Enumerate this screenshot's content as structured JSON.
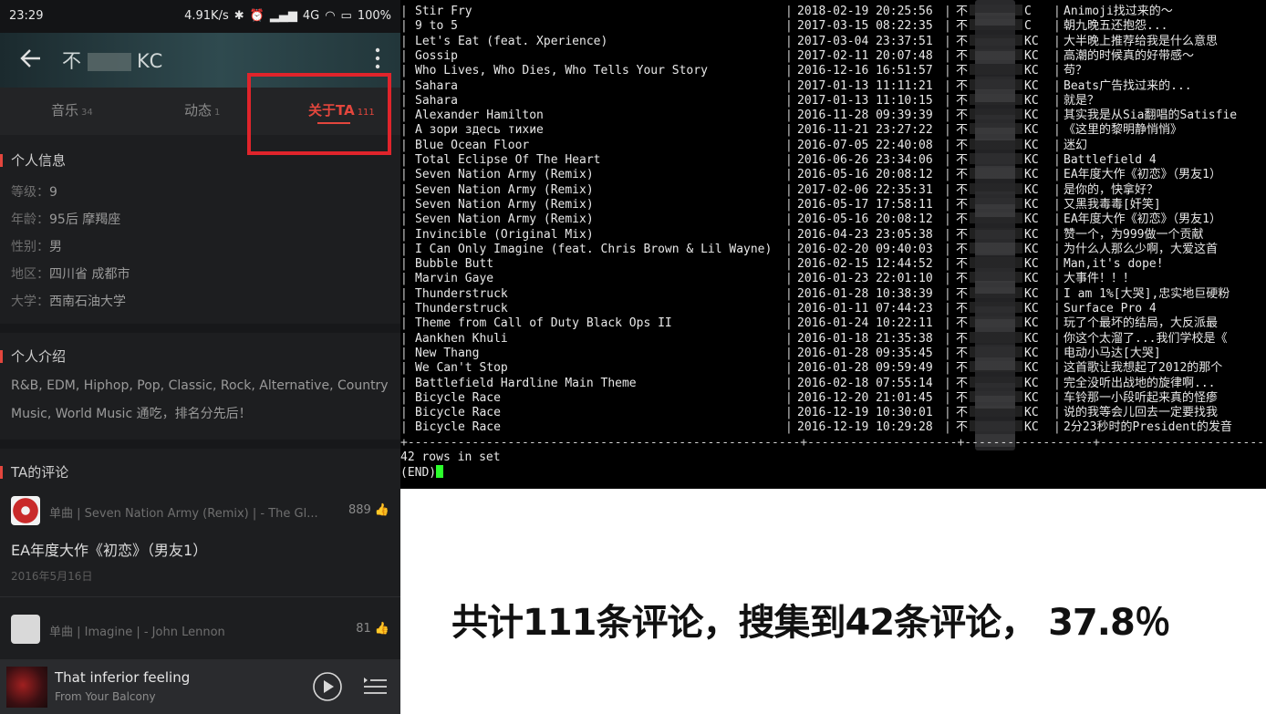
{
  "phone": {
    "status": {
      "time": "23:29",
      "speed": "4.91K/s",
      "network": "4G",
      "battery": "100%"
    },
    "header": {
      "title_prefix": "不",
      "title_suffix": "KC"
    },
    "tabs": [
      {
        "label": "音乐",
        "count": "34"
      },
      {
        "label": "动态",
        "count": "1"
      },
      {
        "label": "关于TA",
        "count": "111"
      }
    ],
    "personal_info": {
      "heading": "个人信息",
      "items": [
        {
          "label": "等级：",
          "value": "9"
        },
        {
          "label": "年龄：",
          "value": "95后 摩羯座"
        },
        {
          "label": "性别：",
          "value": "男"
        },
        {
          "label": "地区：",
          "value": "四川省 成都市"
        },
        {
          "label": "大学：",
          "value": "西南石油大学"
        }
      ]
    },
    "intro": {
      "heading": "个人介绍",
      "text": "R&B, EDM, Hiphop, Pop, Classic, Rock, Alternative, Country Music, World Music 通吃，排名分先后！"
    },
    "comments": {
      "heading": "TA的评论",
      "items": [
        {
          "song": "单曲 | Seven Nation Army (Remix) | - The Gl...",
          "likes": "889",
          "text": "EA年度大作《初恋》（男友1）",
          "date": "2016年5月16日"
        },
        {
          "song": "单曲 | Imagine | - John Lennon",
          "likes": "81",
          "text": "",
          "date": ""
        }
      ]
    },
    "player": {
      "song": "That inferior feeling",
      "artist": "From Your Balcony"
    }
  },
  "terminal": {
    "rows": [
      {
        "song": "Stir Fry",
        "time": "2018-02-19 20:25:56",
        "user_prefix": "不",
        "user_suffix": "C",
        "comment": "Animoji找过来的～"
      },
      {
        "song": "9 to 5",
        "time": "2017-03-15 08:22:35",
        "user_prefix": "不",
        "user_suffix": "C",
        "comment": "朝九晚五还抱怨..."
      },
      {
        "song": "Let's Eat (feat. Xperience)",
        "time": "2017-03-04 23:37:51",
        "user_prefix": "不",
        "user_suffix": "KC",
        "comment": "大半晚上推荐给我是什么意思"
      },
      {
        "song": "Gossip",
        "time": "2017-02-11 20:07:48",
        "user_prefix": "不",
        "user_suffix": "KC",
        "comment": "高潮的时候真的好带感～"
      },
      {
        "song": "Who Lives, Who Dies, Who Tells Your Story",
        "time": "2016-12-16 16:51:57",
        "user_prefix": "不",
        "user_suffix": "KC",
        "comment": "苟？"
      },
      {
        "song": "Sahara",
        "time": "2017-01-13 11:11:21",
        "user_prefix": "不",
        "user_suffix": "KC",
        "comment": "Beats广告找过来的..."
      },
      {
        "song": "Sahara",
        "time": "2017-01-13 11:10:15",
        "user_prefix": "不",
        "user_suffix": "KC",
        "comment": "就是？"
      },
      {
        "song": "Alexander Hamilton",
        "time": "2016-11-28 09:39:39",
        "user_prefix": "不",
        "user_suffix": "KC",
        "comment": "其实我是从Sia翻唱的Satisfie"
      },
      {
        "song": "А зори здесь тихие",
        "time": "2016-11-21 23:27:22",
        "user_prefix": "不",
        "user_suffix": "KC",
        "comment": "《这里的黎明静悄悄》"
      },
      {
        "song": "Blue Ocean Floor",
        "time": "2016-07-05 22:40:08",
        "user_prefix": "不",
        "user_suffix": "KC",
        "comment": "迷幻"
      },
      {
        "song": "Total Eclipse Of The Heart",
        "time": "2016-06-26 23:34:06",
        "user_prefix": "不",
        "user_suffix": "KC",
        "comment": "Battlefield 4"
      },
      {
        "song": "Seven Nation Army (Remix)",
        "time": "2016-05-16 20:08:12",
        "user_prefix": "不",
        "user_suffix": "KC",
        "comment": "EA年度大作《初恋》（男友1）"
      },
      {
        "song": "Seven Nation Army (Remix)",
        "time": "2017-02-06 22:35:31",
        "user_prefix": "不",
        "user_suffix": "KC",
        "comment": "是你的，快拿好？"
      },
      {
        "song": "Seven Nation Army (Remix)",
        "time": "2016-05-17 17:58:11",
        "user_prefix": "不",
        "user_suffix": "KC",
        "comment": "又黑我毒毒[奸笑]"
      },
      {
        "song": "Seven Nation Army (Remix)",
        "time": "2016-05-16 20:08:12",
        "user_prefix": "不",
        "user_suffix": "KC",
        "comment": "EA年度大作《初恋》（男友1）"
      },
      {
        "song": "Invincible (Original Mix)",
        "time": "2016-04-23 23:05:38",
        "user_prefix": "不",
        "user_suffix": "KC",
        "comment": "赞一个，为999做一个贡献"
      },
      {
        "song": "I Can Only Imagine (feat. Chris Brown & Lil Wayne)",
        "time": "2016-02-20 09:40:03",
        "user_prefix": "不",
        "user_suffix": "KC",
        "comment": "为什么人那么少啊，大爱这首"
      },
      {
        "song": "Bubble Butt",
        "time": "2016-02-15 12:44:52",
        "user_prefix": "不",
        "user_suffix": "KC",
        "comment": "Man,it's dope!"
      },
      {
        "song": "Marvin Gaye",
        "time": "2016-01-23 22:01:10",
        "user_prefix": "不",
        "user_suffix": "KC",
        "comment": "大事件！！！"
      },
      {
        "song": "Thunderstruck",
        "time": "2016-01-28 10:38:39",
        "user_prefix": "不",
        "user_suffix": "KC",
        "comment": "I am 1%[大哭],忠实地巨硬粉"
      },
      {
        "song": "Thunderstruck",
        "time": "2016-01-11 07:44:23",
        "user_prefix": "不",
        "user_suffix": "KC",
        "comment": "Surface Pro 4"
      },
      {
        "song": "Theme from Call of Duty Black Ops II",
        "time": "2016-01-24 10:22:11",
        "user_prefix": "不",
        "user_suffix": "KC",
        "comment": "玩了个最坏的结局，大反派最"
      },
      {
        "song": "Aankhen Khuli",
        "time": "2016-01-18 21:35:38",
        "user_prefix": "不",
        "user_suffix": "KC",
        "comment": "你这个太溜了...我们学校是《"
      },
      {
        "song": "New Thang",
        "time": "2016-01-28 09:35:45",
        "user_prefix": "不",
        "user_suffix": "KC",
        "comment": "电动小马达[大哭]"
      },
      {
        "song": "We Can't Stop",
        "time": "2016-01-28 09:59:49",
        "user_prefix": "不",
        "user_suffix": "KC",
        "comment": "这首歌让我想起了2012的那个"
      },
      {
        "song": "Battlefield Hardline Main Theme",
        "time": "2016-02-18 07:55:14",
        "user_prefix": "不",
        "user_suffix": "KC",
        "comment": "完全没听出战地的旋律啊..."
      },
      {
        "song": "Bicycle Race",
        "time": "2016-12-20 21:01:45",
        "user_prefix": "不",
        "user_suffix": "KC",
        "comment": "车铃那一小段听起来真的怪瘆"
      },
      {
        "song": "Bicycle Race",
        "time": "2016-12-19 10:30:01",
        "user_prefix": "不",
        "user_suffix": "KC",
        "comment": "说的我等会儿回去一定要找我"
      },
      {
        "song": "Bicycle Race",
        "time": "2016-12-19 10:29:28",
        "user_prefix": "不",
        "user_suffix": "KC",
        "comment": "2分23秒时的President的发音"
      }
    ],
    "separator": "+-------------------------------------------------------+---------------------+------------------+---------------------------+",
    "footer_rows": "42 rows in set",
    "footer_end": "(END)"
  },
  "summary": {
    "text": "共计111条评论，搜集到42条评论， 37.8％"
  },
  "colors": {
    "accent_red": "#e3463d",
    "highlight_box": "#e0242b",
    "cursor_green": "#2cff2c"
  }
}
